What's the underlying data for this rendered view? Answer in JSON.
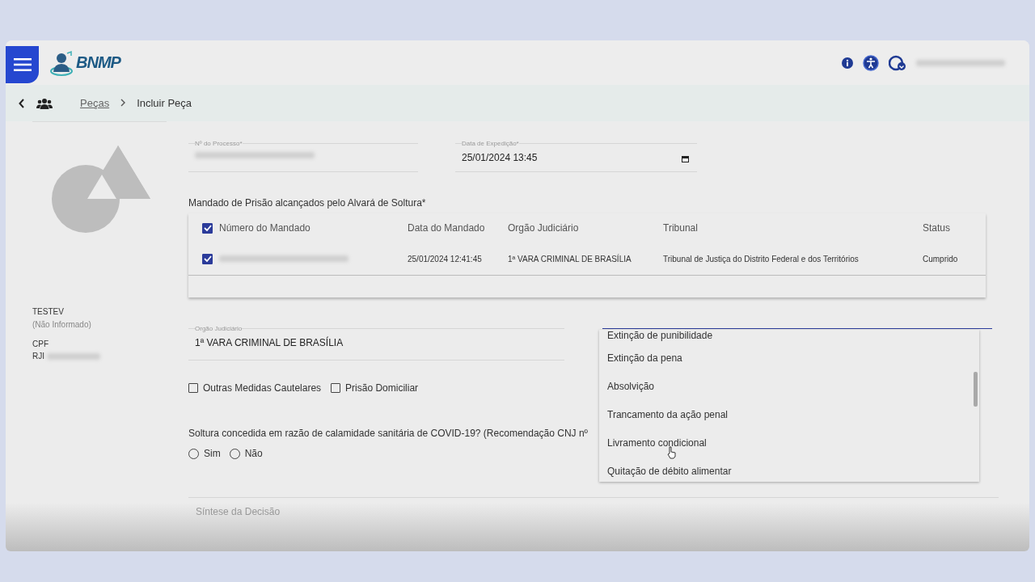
{
  "header": {
    "logo_text": "BNMP"
  },
  "breadcrumb": {
    "link": "Peças",
    "current": "Incluir Peça"
  },
  "person": {
    "name": "TESTEV",
    "subtitle": "(Não Informado)",
    "cpf_label": "CPF",
    "rji_label": "RJI"
  },
  "fields": {
    "processo_label": "Nº do Processo*",
    "data_label": "Data de Expedição*",
    "data_value": "25/01/2024 13:45"
  },
  "mandados": {
    "title": "Mandado de Prisão alcançados pelo Alvará de Soltura*",
    "all_checked": true,
    "columns": [
      "Número do Mandado",
      "Data do Mandado",
      "Orgão Judiciário",
      "Tribunal",
      "Status"
    ],
    "rows": [
      {
        "checked": true,
        "data": "25/01/2024 12:41:45",
        "orgao": "1ª VARA CRIMINAL DE BRASÍLIA",
        "tribunal": "Tribunal de Justiça do Distrito Federal e dos Territórios",
        "status": "Cumprido"
      }
    ]
  },
  "orgao_field": {
    "label": "Orgão Judiciário",
    "value": "1ª VARA CRIMINAL DE BRASÍLIA"
  },
  "checkboxes": [
    {
      "label": "Outras Medidas Cautelares",
      "checked": false
    },
    {
      "label": "Prisão Domiciliar",
      "checked": false
    }
  ],
  "covid": {
    "question": "Soltura concedida em razão de calamidade sanitária de COVID-19? (Recomendação CNJ nº",
    "options": [
      {
        "label": "Sim",
        "selected": false
      },
      {
        "label": "Não",
        "selected": false
      }
    ]
  },
  "sintese": {
    "placeholder": "Síntese da Decisão"
  },
  "dropdown": {
    "options": [
      {
        "label": "Extinção de punibilidade",
        "selected": false
      },
      {
        "label": "Extinção da pena",
        "selected": false
      },
      {
        "label": "Absolvição",
        "selected": false
      },
      {
        "label": "Trancamento da ação penal",
        "selected": false
      },
      {
        "label": "Livramento condicional",
        "selected": false
      },
      {
        "label": "Quitação de débito alimentar",
        "selected": false
      }
    ]
  }
}
